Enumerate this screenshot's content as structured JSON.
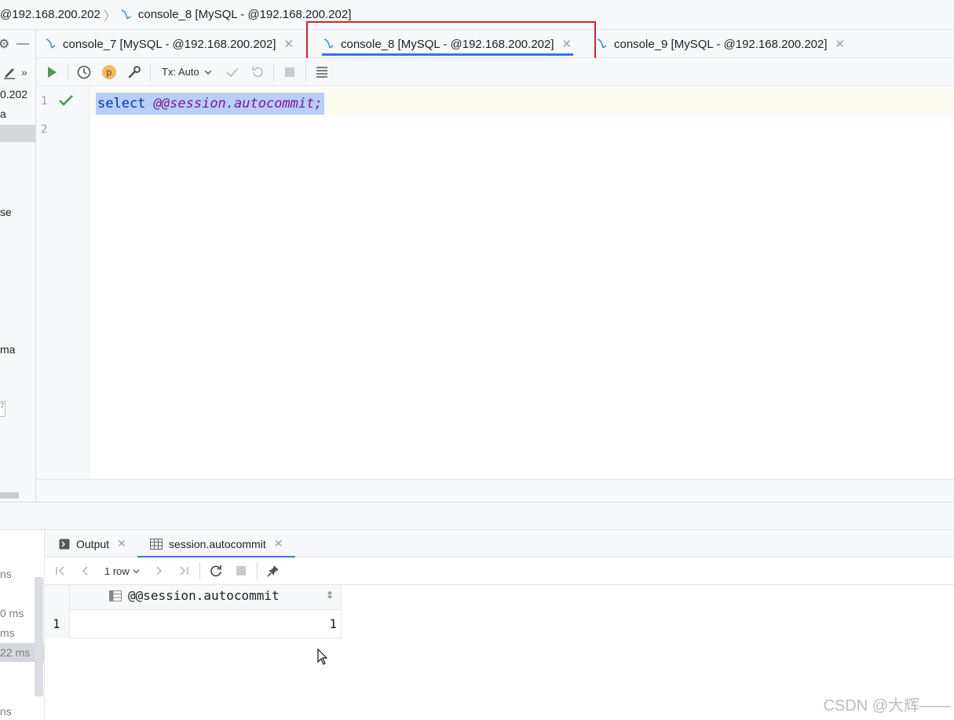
{
  "breadcrumb": {
    "host": "@192.168.200.202",
    "console": "console_8 [MySQL - @192.168.200.202]"
  },
  "left_panel": {
    "items": [
      "0.202",
      "a",
      "se",
      "ma"
    ],
    "box_text": "7"
  },
  "tabs": [
    {
      "label": "console_7 [MySQL - @192.168.200.202]",
      "active": false
    },
    {
      "label": "console_8 [MySQL - @192.168.200.202]",
      "active": true
    },
    {
      "label": "console_9 [MySQL - @192.168.200.202]",
      "active": false
    }
  ],
  "toolbar": {
    "tx_mode": "Tx: Auto",
    "p_badge": "p"
  },
  "editor": {
    "lines": [
      "1",
      "2"
    ],
    "code_keyword": "select",
    "code_variable": "@@session.autocommit",
    "code_end": ";"
  },
  "services": {
    "items": [
      "ns",
      "0 ms",
      "ms",
      "22 ms",
      "ns"
    ]
  },
  "results": {
    "tabs": [
      {
        "label": "Output",
        "active": false
      },
      {
        "label": "session.autocommit",
        "active": true
      }
    ],
    "rows_label": "1 row",
    "column": "@@session.autocommit",
    "row_number": "1",
    "value": "1"
  },
  "watermark": "CSDN @大辉——",
  "colors": {
    "accent": "#3574f0",
    "highlight_frame": "#e0202a",
    "selection": "#b6d0f7",
    "run_green": "#499c54"
  }
}
